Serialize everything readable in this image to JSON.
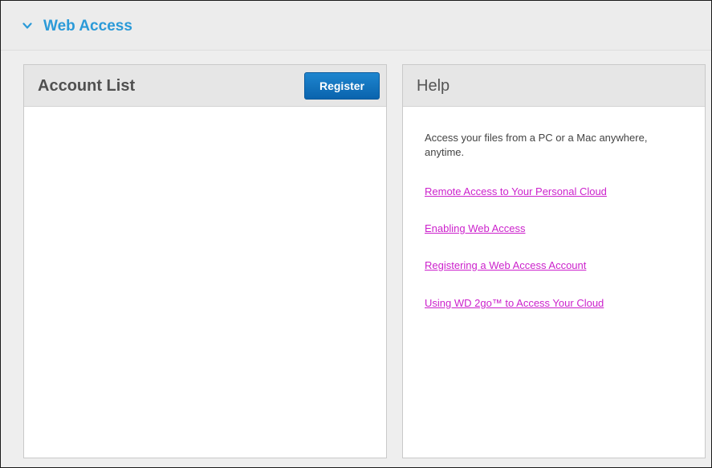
{
  "section": {
    "title": "Web Access",
    "toggle_icon": "chevron-down-icon"
  },
  "account_panel": {
    "title": "Account List",
    "register_label": "Register",
    "accounts": []
  },
  "help_panel": {
    "title": "Help",
    "intro": "Access your files from a PC or a Mac anywhere, anytime.",
    "links": [
      "Remote Access to Your Personal Cloud",
      "Enabling Web Access",
      "Registering a Web Access Account",
      "Using WD 2go™ to Access Your Cloud"
    ]
  },
  "colors": {
    "accent": "#2b9ad8",
    "button": "#0a63ad",
    "link": "#cc22cc"
  }
}
